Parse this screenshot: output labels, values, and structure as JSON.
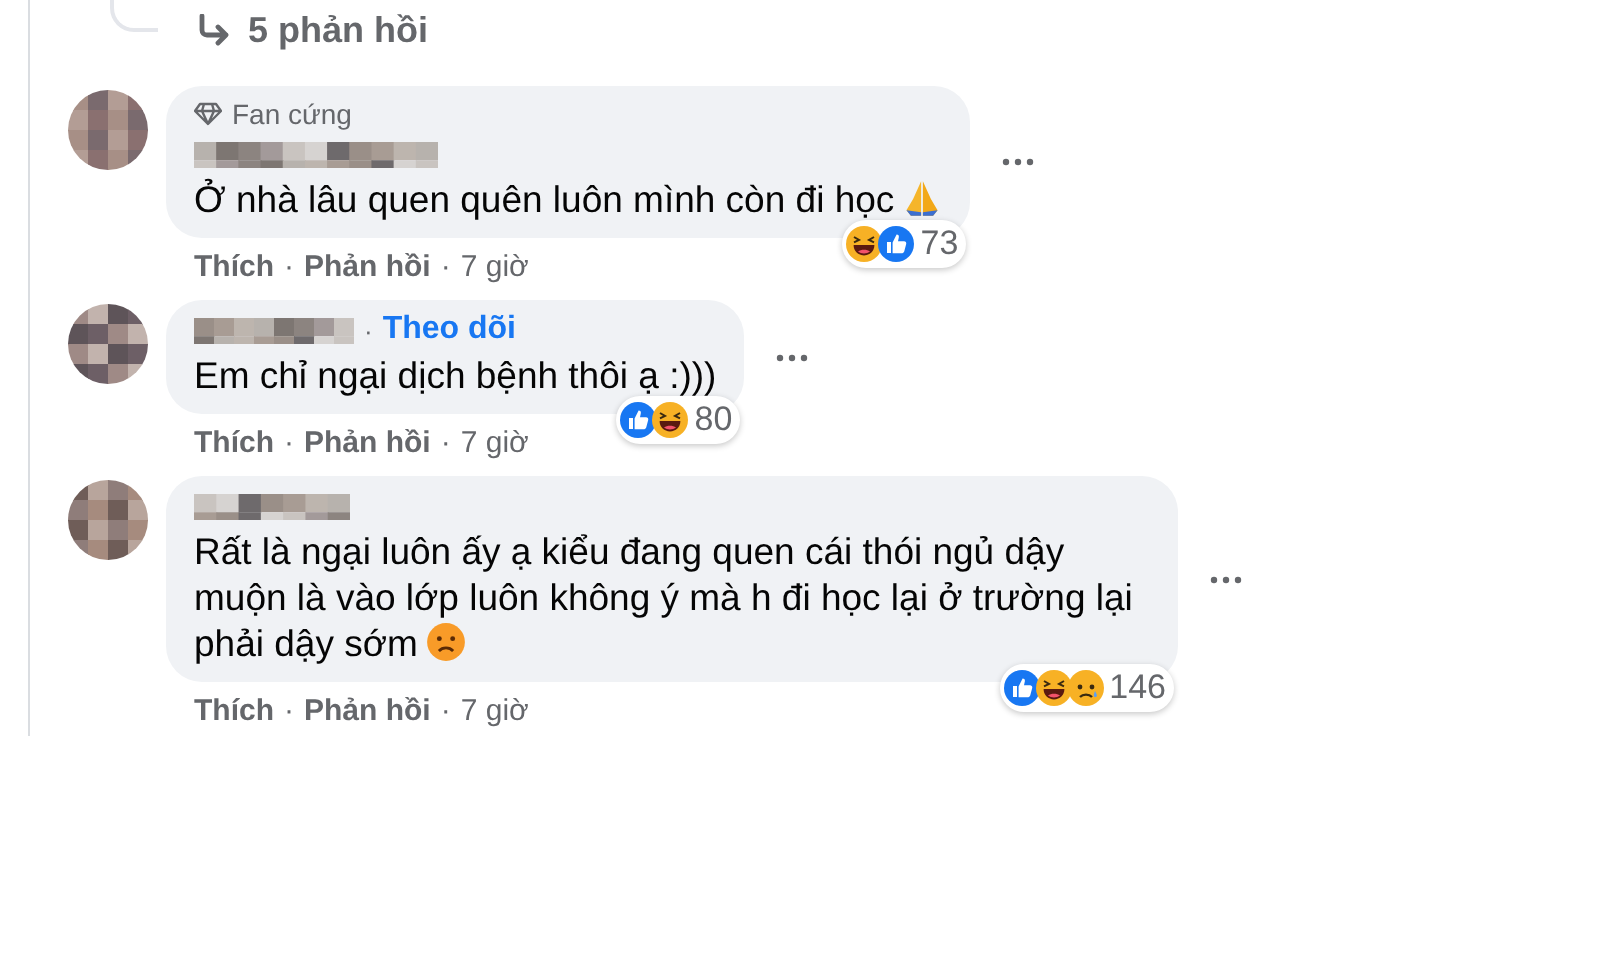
{
  "replies_link": {
    "label": "5 phản hồi"
  },
  "comments": [
    {
      "badge": {
        "kind": "fan",
        "label": "Fan cứng"
      },
      "text": "Ở nhà lâu quen quên luôn mình còn đi học",
      "trailing_emoji": {
        "kind": "pray"
      },
      "actions": [
        {
          "kind": "link",
          "label": "Thích"
        },
        {
          "kind": "separator",
          "label": "·"
        },
        {
          "kind": "link",
          "label": "Phản hồi"
        },
        {
          "kind": "separator",
          "label": "·"
        },
        {
          "kind": "time",
          "label": "7 giờ"
        }
      ],
      "reactions": [
        {
          "kind": "haha"
        },
        {
          "kind": "like"
        }
      ],
      "reaction_count": "73"
    },
    {
      "follow_link": {
        "separator": "·",
        "label": "Theo dõi"
      },
      "text": "Em chỉ ngại dịch bệnh thôi ạ :)))",
      "actions": [
        {
          "kind": "link",
          "label": "Thích"
        },
        {
          "kind": "separator",
          "label": "·"
        },
        {
          "kind": "link",
          "label": "Phản hồi"
        },
        {
          "kind": "separator",
          "label": "·"
        },
        {
          "kind": "time",
          "label": "7 giờ"
        }
      ],
      "reactions": [
        {
          "kind": "like"
        },
        {
          "kind": "haha"
        }
      ],
      "reaction_count": "80"
    },
    {
      "text": "Rất là ngại luôn ấy ạ kiểu đang quen cái thói ngủ dậy muộn là vào lớp luôn không ý mà h đi học lại ở trường lại phải dậy sớm",
      "trailing_emoji": {
        "kind": "sad"
      },
      "actions": [
        {
          "kind": "link",
          "label": "Thích"
        },
        {
          "kind": "separator",
          "label": "·"
        },
        {
          "kind": "link",
          "label": "Phản hồi"
        },
        {
          "kind": "separator",
          "label": "·"
        },
        {
          "kind": "time",
          "label": "7 giờ"
        }
      ],
      "reactions": [
        {
          "kind": "like"
        },
        {
          "kind": "haha"
        },
        {
          "kind": "sad"
        }
      ],
      "reaction_count": "146"
    }
  ]
}
